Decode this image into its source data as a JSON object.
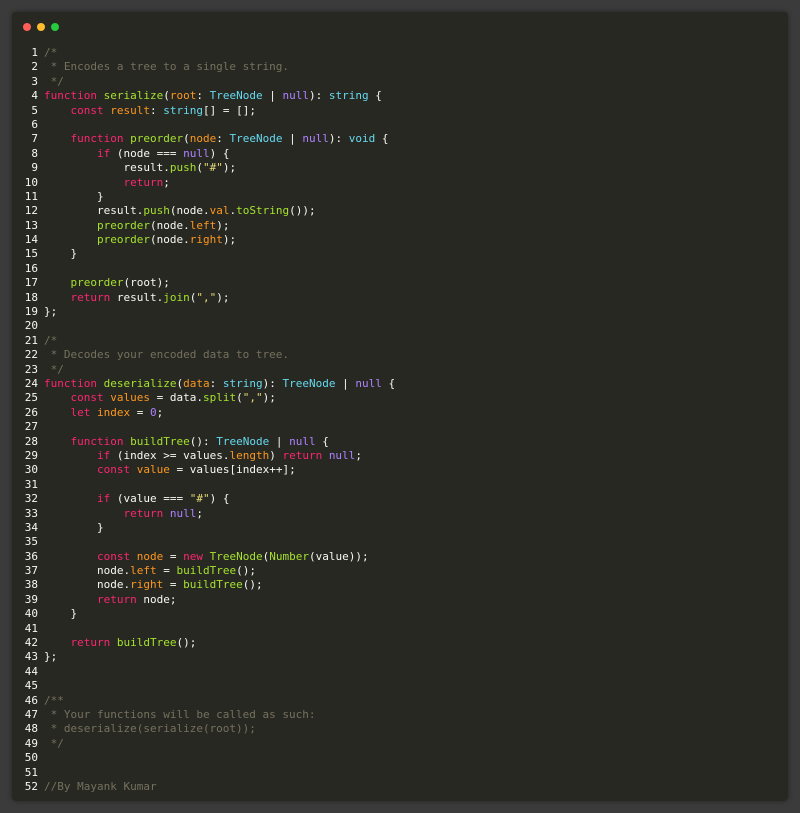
{
  "window": {
    "controls": {
      "close_color": "#ff5f56",
      "minimize_color": "#ffbd2e",
      "zoom_color": "#27c93f"
    }
  },
  "theme": {
    "background": "#272822",
    "keyword": "#f92672",
    "function": "#a6e22e",
    "type": "#66d9ef",
    "string": "#e6db74",
    "comment": "#75715e",
    "param": "#fd971f",
    "literal": "#ae81ff",
    "text": "#f8f8f2"
  },
  "code": {
    "lines": [
      {
        "n": "1",
        "tokens": [
          [
            "c",
            "/*"
          ]
        ]
      },
      {
        "n": "2",
        "tokens": [
          [
            "c",
            " * Encodes a tree to a single string."
          ]
        ]
      },
      {
        "n": "3",
        "tokens": [
          [
            "c",
            " */"
          ]
        ]
      },
      {
        "n": "4",
        "tokens": [
          [
            "k",
            "function "
          ],
          [
            "f",
            "serialize"
          ],
          [
            "w",
            "("
          ],
          [
            "p",
            "root"
          ],
          [
            "w",
            ": "
          ],
          [
            "t",
            "TreeNode"
          ],
          [
            "w",
            " | "
          ],
          [
            "n",
            "null"
          ],
          [
            "w",
            "): "
          ],
          [
            "t",
            "string"
          ],
          [
            "w",
            " {"
          ]
        ]
      },
      {
        "n": "5",
        "tokens": [
          [
            "w",
            "    "
          ],
          [
            "k",
            "const "
          ],
          [
            "p",
            "result"
          ],
          [
            "w",
            ": "
          ],
          [
            "t",
            "string"
          ],
          [
            "w",
            "[] = [];"
          ]
        ]
      },
      {
        "n": "6",
        "tokens": []
      },
      {
        "n": "7",
        "tokens": [
          [
            "w",
            "    "
          ],
          [
            "k",
            "function "
          ],
          [
            "f",
            "preorder"
          ],
          [
            "w",
            "("
          ],
          [
            "p",
            "node"
          ],
          [
            "w",
            ": "
          ],
          [
            "t",
            "TreeNode"
          ],
          [
            "w",
            " | "
          ],
          [
            "n",
            "null"
          ],
          [
            "w",
            "): "
          ],
          [
            "t",
            "void"
          ],
          [
            "w",
            " {"
          ]
        ]
      },
      {
        "n": "8",
        "tokens": [
          [
            "w",
            "        "
          ],
          [
            "k",
            "if"
          ],
          [
            "w",
            " (node === "
          ],
          [
            "n",
            "null"
          ],
          [
            "w",
            ") {"
          ]
        ]
      },
      {
        "n": "9",
        "tokens": [
          [
            "w",
            "            result."
          ],
          [
            "f",
            "push"
          ],
          [
            "w",
            "("
          ],
          [
            "s",
            "\"#\""
          ],
          [
            "w",
            ");"
          ]
        ]
      },
      {
        "n": "10",
        "tokens": [
          [
            "w",
            "            "
          ],
          [
            "k",
            "return"
          ],
          [
            "w",
            ";"
          ]
        ]
      },
      {
        "n": "11",
        "tokens": [
          [
            "w",
            "        }"
          ]
        ]
      },
      {
        "n": "12",
        "tokens": [
          [
            "w",
            "        result."
          ],
          [
            "f",
            "push"
          ],
          [
            "w",
            "(node."
          ],
          [
            "p",
            "val"
          ],
          [
            "w",
            "."
          ],
          [
            "f",
            "toString"
          ],
          [
            "w",
            "());"
          ]
        ]
      },
      {
        "n": "13",
        "tokens": [
          [
            "w",
            "        "
          ],
          [
            "f",
            "preorder"
          ],
          [
            "w",
            "(node."
          ],
          [
            "p",
            "left"
          ],
          [
            "w",
            ");"
          ]
        ]
      },
      {
        "n": "14",
        "tokens": [
          [
            "w",
            "        "
          ],
          [
            "f",
            "preorder"
          ],
          [
            "w",
            "(node."
          ],
          [
            "p",
            "right"
          ],
          [
            "w",
            ");"
          ]
        ]
      },
      {
        "n": "15",
        "tokens": [
          [
            "w",
            "    }"
          ]
        ]
      },
      {
        "n": "16",
        "tokens": []
      },
      {
        "n": "17",
        "tokens": [
          [
            "w",
            "    "
          ],
          [
            "f",
            "preorder"
          ],
          [
            "w",
            "(root);"
          ]
        ]
      },
      {
        "n": "18",
        "tokens": [
          [
            "w",
            "    "
          ],
          [
            "k",
            "return"
          ],
          [
            "w",
            " result."
          ],
          [
            "f",
            "join"
          ],
          [
            "w",
            "("
          ],
          [
            "s",
            "\",\""
          ],
          [
            "w",
            ");"
          ]
        ]
      },
      {
        "n": "19",
        "tokens": [
          [
            "w",
            "};"
          ]
        ]
      },
      {
        "n": "20",
        "tokens": []
      },
      {
        "n": "21",
        "tokens": [
          [
            "c",
            "/*"
          ]
        ]
      },
      {
        "n": "22",
        "tokens": [
          [
            "c",
            " * Decodes your encoded data to tree."
          ]
        ]
      },
      {
        "n": "23",
        "tokens": [
          [
            "c",
            " */"
          ]
        ]
      },
      {
        "n": "24",
        "tokens": [
          [
            "k",
            "function "
          ],
          [
            "f",
            "deserialize"
          ],
          [
            "w",
            "("
          ],
          [
            "p",
            "data"
          ],
          [
            "w",
            ": "
          ],
          [
            "t",
            "string"
          ],
          [
            "w",
            "): "
          ],
          [
            "t",
            "TreeNode"
          ],
          [
            "w",
            " | "
          ],
          [
            "n",
            "null"
          ],
          [
            "w",
            " {"
          ]
        ]
      },
      {
        "n": "25",
        "tokens": [
          [
            "w",
            "    "
          ],
          [
            "k",
            "const "
          ],
          [
            "p",
            "values"
          ],
          [
            "w",
            " = data."
          ],
          [
            "f",
            "split"
          ],
          [
            "w",
            "("
          ],
          [
            "s",
            "\",\""
          ],
          [
            "w",
            ");"
          ]
        ]
      },
      {
        "n": "26",
        "tokens": [
          [
            "w",
            "    "
          ],
          [
            "k",
            "let "
          ],
          [
            "p",
            "index"
          ],
          [
            "w",
            " = "
          ],
          [
            "n",
            "0"
          ],
          [
            "w",
            ";"
          ]
        ]
      },
      {
        "n": "27",
        "tokens": []
      },
      {
        "n": "28",
        "tokens": [
          [
            "w",
            "    "
          ],
          [
            "k",
            "function "
          ],
          [
            "f",
            "buildTree"
          ],
          [
            "w",
            "(): "
          ],
          [
            "t",
            "TreeNode"
          ],
          [
            "w",
            " | "
          ],
          [
            "n",
            "null"
          ],
          [
            "w",
            " {"
          ]
        ]
      },
      {
        "n": "29",
        "tokens": [
          [
            "w",
            "        "
          ],
          [
            "k",
            "if"
          ],
          [
            "w",
            " (index >= values."
          ],
          [
            "p",
            "length"
          ],
          [
            "w",
            ") "
          ],
          [
            "k",
            "return "
          ],
          [
            "n",
            "null"
          ],
          [
            "w",
            ";"
          ]
        ]
      },
      {
        "n": "30",
        "tokens": [
          [
            "w",
            "        "
          ],
          [
            "k",
            "const "
          ],
          [
            "p",
            "value"
          ],
          [
            "w",
            " = values[index++];"
          ]
        ]
      },
      {
        "n": "31",
        "tokens": []
      },
      {
        "n": "32",
        "tokens": [
          [
            "w",
            "        "
          ],
          [
            "k",
            "if"
          ],
          [
            "w",
            " (value === "
          ],
          [
            "s",
            "\"#\""
          ],
          [
            "w",
            ") {"
          ]
        ]
      },
      {
        "n": "33",
        "tokens": [
          [
            "w",
            "            "
          ],
          [
            "k",
            "return "
          ],
          [
            "n",
            "null"
          ],
          [
            "w",
            ";"
          ]
        ]
      },
      {
        "n": "34",
        "tokens": [
          [
            "w",
            "        }"
          ]
        ]
      },
      {
        "n": "35",
        "tokens": []
      },
      {
        "n": "36",
        "tokens": [
          [
            "w",
            "        "
          ],
          [
            "k",
            "const "
          ],
          [
            "p",
            "node"
          ],
          [
            "w",
            " = "
          ],
          [
            "k",
            "new "
          ],
          [
            "f",
            "TreeNode"
          ],
          [
            "w",
            "("
          ],
          [
            "f",
            "Number"
          ],
          [
            "w",
            "(value));"
          ]
        ]
      },
      {
        "n": "37",
        "tokens": [
          [
            "w",
            "        node."
          ],
          [
            "p",
            "left"
          ],
          [
            "w",
            " = "
          ],
          [
            "f",
            "buildTree"
          ],
          [
            "w",
            "();"
          ]
        ]
      },
      {
        "n": "38",
        "tokens": [
          [
            "w",
            "        node."
          ],
          [
            "p",
            "right"
          ],
          [
            "w",
            " = "
          ],
          [
            "f",
            "buildTree"
          ],
          [
            "w",
            "();"
          ]
        ]
      },
      {
        "n": "39",
        "tokens": [
          [
            "w",
            "        "
          ],
          [
            "k",
            "return"
          ],
          [
            "w",
            " node;"
          ]
        ]
      },
      {
        "n": "40",
        "tokens": [
          [
            "w",
            "    }"
          ]
        ]
      },
      {
        "n": "41",
        "tokens": []
      },
      {
        "n": "42",
        "tokens": [
          [
            "w",
            "    "
          ],
          [
            "k",
            "return "
          ],
          [
            "f",
            "buildTree"
          ],
          [
            "w",
            "();"
          ]
        ]
      },
      {
        "n": "43",
        "tokens": [
          [
            "w",
            "};"
          ]
        ]
      },
      {
        "n": "44",
        "tokens": []
      },
      {
        "n": "45",
        "tokens": []
      },
      {
        "n": "46",
        "tokens": [
          [
            "c",
            "/**"
          ]
        ]
      },
      {
        "n": "47",
        "tokens": [
          [
            "c",
            " * Your functions will be called as such:"
          ]
        ]
      },
      {
        "n": "48",
        "tokens": [
          [
            "c",
            " * deserialize(serialize(root));"
          ]
        ]
      },
      {
        "n": "49",
        "tokens": [
          [
            "c",
            " */"
          ]
        ]
      },
      {
        "n": "50",
        "tokens": []
      },
      {
        "n": "51",
        "tokens": []
      },
      {
        "n": "52",
        "tokens": [
          [
            "c",
            "//By Mayank Kumar"
          ]
        ]
      }
    ]
  }
}
